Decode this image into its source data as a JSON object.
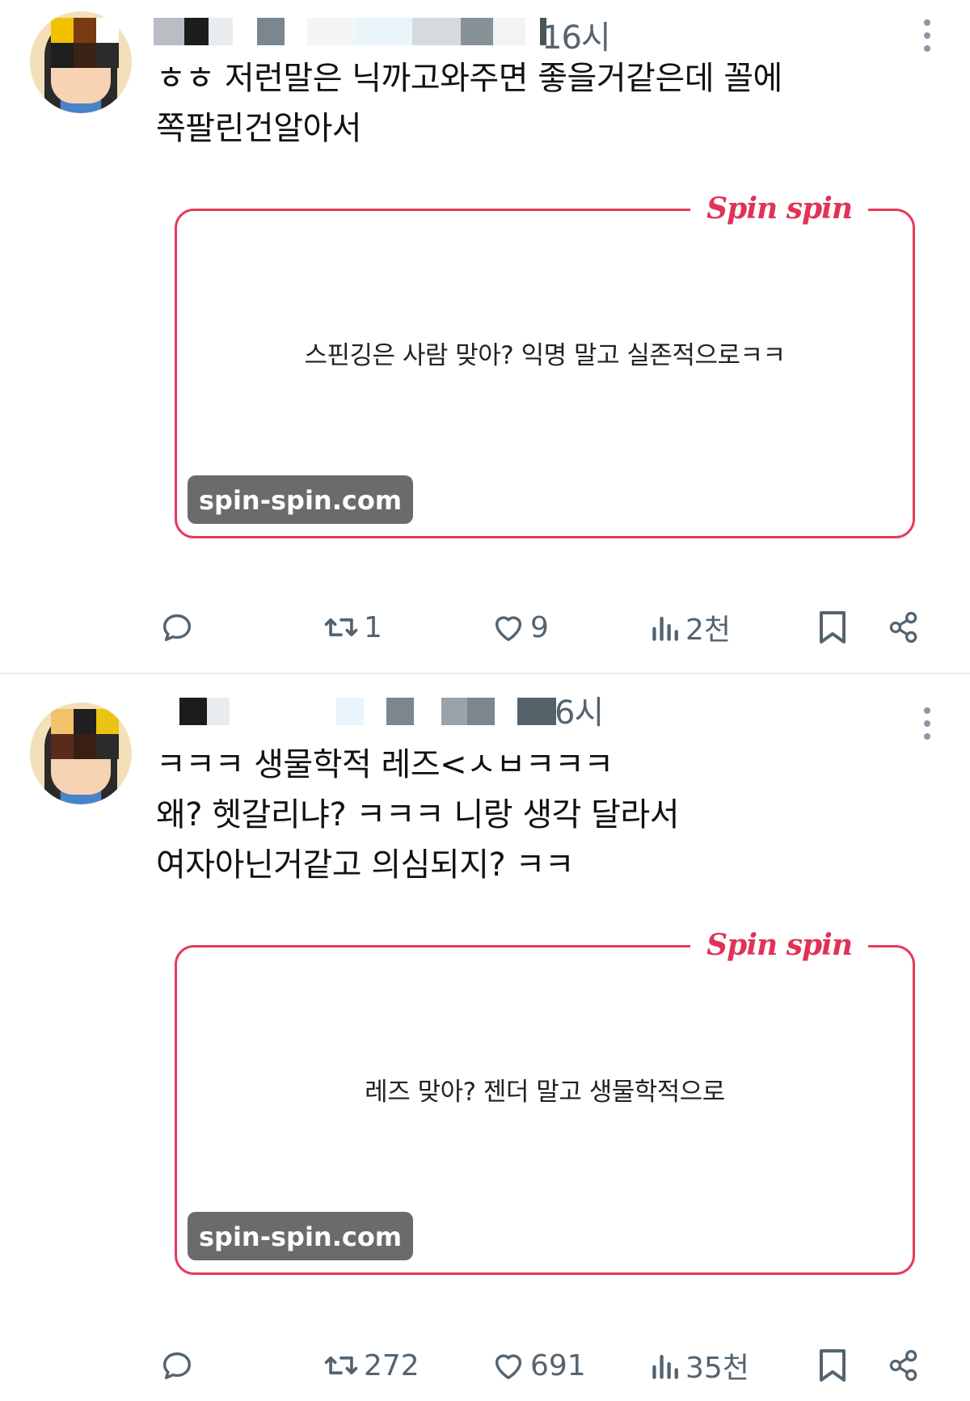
{
  "colors": {
    "accent": "#e63a5c",
    "muted": "#536471",
    "badge_bg": "#6b6b6b"
  },
  "tweets": [
    {
      "time": "16시",
      "text": "ㅎㅎ 저런말은 닉까고와주면 좋을거같은데 꼴에\n쪽팔린건알아서",
      "card": {
        "brand": "Spin spin",
        "question": "스핀깅은 사람 맞아? 익명 말고 실존적으로ㅋㅋ",
        "url": "spin-spin.com"
      },
      "stats": {
        "retweets": "1",
        "likes": "9",
        "views": "2천"
      }
    },
    {
      "time": "6시",
      "text": "ㅋㅋㅋ 생물학적 레즈<ㅅㅂㅋㅋㅋ\n왜? 헷갈리냐? ㅋㅋㅋ 니랑 생각 달라서\n여자아닌거같고 의심되지? ㅋㅋ",
      "card": {
        "brand": "Spin spin",
        "question": "레즈 맞아? 젠더 말고 생물학적으로",
        "url": "spin-spin.com"
      },
      "stats": {
        "retweets": "272",
        "likes": "691",
        "views": "35천"
      }
    }
  ],
  "icons": [
    "reply-icon",
    "retweet-icon",
    "like-icon",
    "views-icon",
    "bookmark-icon",
    "share-icon",
    "more-icon"
  ]
}
